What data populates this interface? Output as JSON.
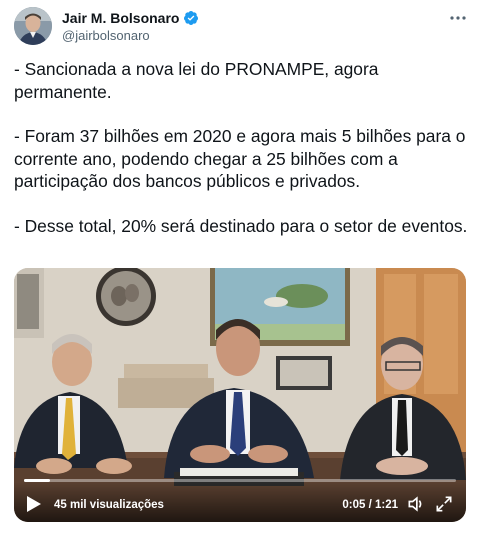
{
  "tweet": {
    "author_name": "Jair M. Bolsonaro",
    "handle": "@jairbolsonaro",
    "verified": true,
    "paragraphs": [
      "- Sancionada a nova lei do PRONAMPE, agora permanente.",
      "- Foram 37 bilhões em 2020 e agora mais 5 bilhões para o corrente ano, podendo chegar a 25 bilhões com a participação dos bancos públicos e privados.",
      "- Desse total, 20% será destinado para o setor de eventos."
    ]
  },
  "video": {
    "views": "45 mil visualizações",
    "time": "0:05 / 1:21",
    "progress_fraction": 0.06
  },
  "colors": {
    "text": "#0f1419",
    "secondary": "#536471",
    "verified": "#1d9bf0"
  },
  "icons": [
    "verified-badge-icon",
    "more-options-icon",
    "play-icon",
    "volume-icon",
    "fullscreen-icon"
  ]
}
